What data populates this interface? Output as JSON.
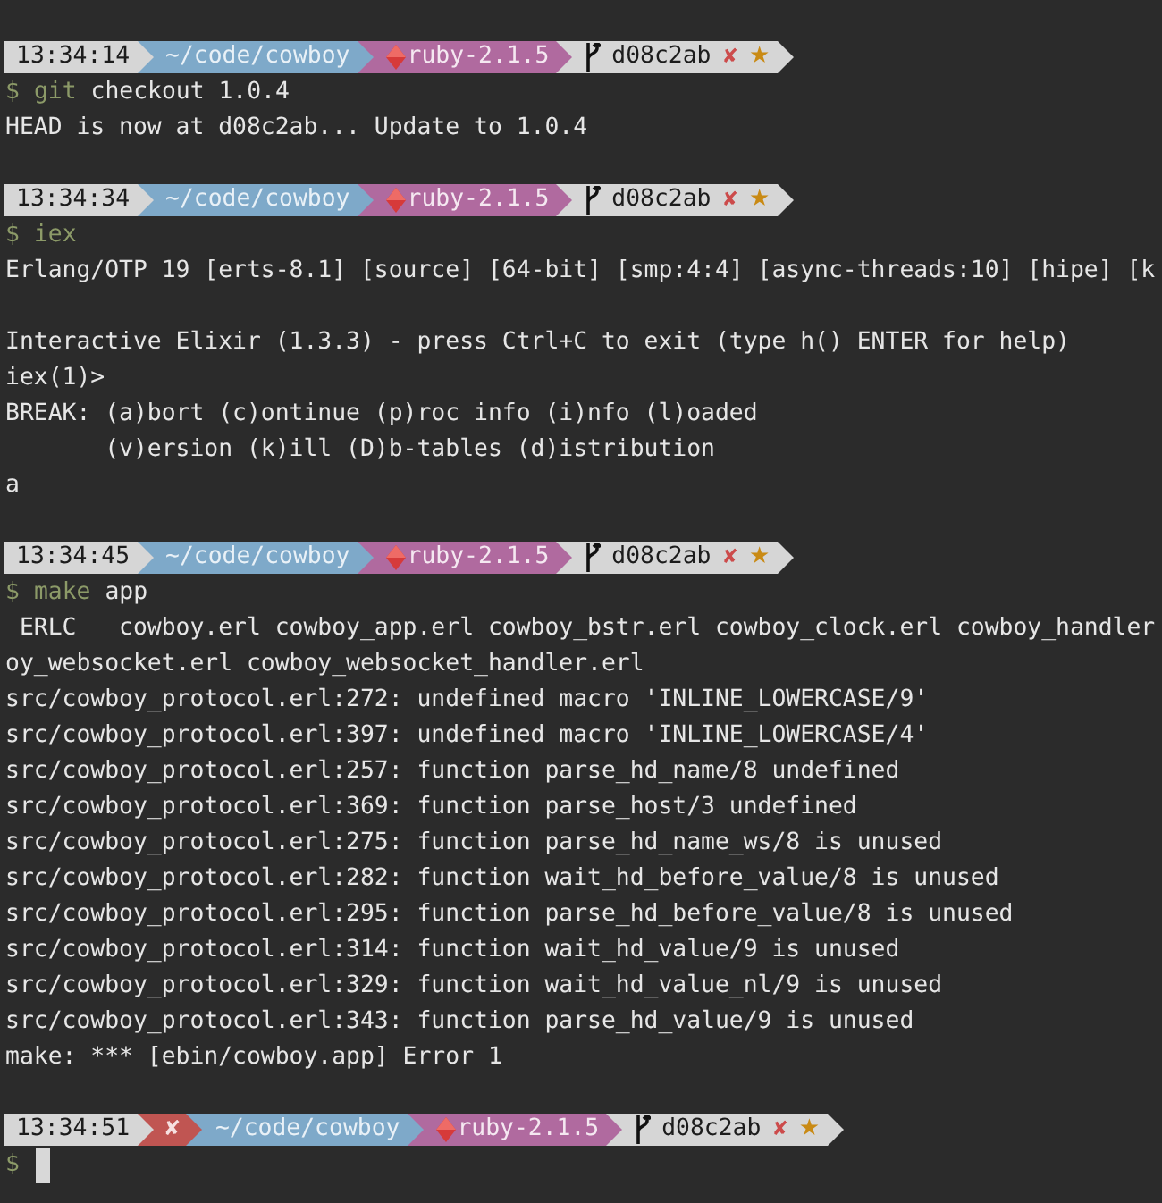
{
  "blocks": [
    {
      "prompt": {
        "segments": [
          {
            "kind": "time",
            "text": "13:34:14",
            "color": "#d6d6d6"
          },
          {
            "kind": "path",
            "text": "~/code/cowboy",
            "color": "#7ea9c9"
          },
          {
            "kind": "ruby",
            "text": "ruby-2.1.5",
            "color": "#b06a9f"
          },
          {
            "kind": "git",
            "text": "d08c2ab",
            "color": "#d6d6d6",
            "marks": [
              {
                "text": "✘",
                "color": "#cc4b4b"
              },
              {
                "text": "★",
                "color": "#c98a14"
              }
            ]
          }
        ]
      },
      "command": {
        "symbol": "$",
        "program": "git",
        "args": "checkout 1.0.4"
      },
      "output": [
        {
          "kind": "text",
          "text": "HEAD is now at d08c2ab... Update to 1.0.4"
        },
        {
          "kind": "blank"
        }
      ]
    },
    {
      "prompt": {
        "segments": [
          {
            "kind": "time",
            "text": "13:34:34",
            "color": "#d6d6d6"
          },
          {
            "kind": "path",
            "text": "~/code/cowboy",
            "color": "#7ea9c9"
          },
          {
            "kind": "ruby",
            "text": "ruby-2.1.5",
            "color": "#b06a9f"
          },
          {
            "kind": "git",
            "text": "d08c2ab",
            "color": "#d6d6d6",
            "marks": [
              {
                "text": "✘",
                "color": "#cc4b4b"
              },
              {
                "text": "★",
                "color": "#c98a14"
              }
            ]
          }
        ]
      },
      "command": {
        "symbol": "$",
        "program": "iex"
      },
      "output": [
        {
          "kind": "text",
          "text": "Erlang/OTP 19 [erts-8.1] [source] [64-bit] [smp:4:4] [async-threads:10] [hipe] [k"
        },
        {
          "kind": "blank"
        },
        {
          "kind": "text",
          "text": "Interactive Elixir (1.3.3) - press Ctrl+C to exit (type h() ENTER for help)"
        },
        {
          "kind": "text",
          "text": "iex(1)>"
        },
        {
          "kind": "text",
          "text": "BREAK: (a)bort (c)ontinue (p)roc info (i)nfo (l)oaded"
        },
        {
          "kind": "text",
          "text": "       (v)ersion (k)ill (D)b-tables (d)istribution"
        },
        {
          "kind": "text",
          "text": "a"
        },
        {
          "kind": "blank"
        }
      ]
    },
    {
      "prompt": {
        "segments": [
          {
            "kind": "time",
            "text": "13:34:45",
            "color": "#d6d6d6"
          },
          {
            "kind": "path",
            "text": "~/code/cowboy",
            "color": "#7ea9c9"
          },
          {
            "kind": "ruby",
            "text": "ruby-2.1.5",
            "color": "#b06a9f"
          },
          {
            "kind": "git",
            "text": "d08c2ab",
            "color": "#d6d6d6",
            "marks": [
              {
                "text": "✘",
                "color": "#cc4b4b"
              },
              {
                "text": "★",
                "color": "#c98a14"
              }
            ]
          }
        ]
      },
      "command": {
        "symbol": "$",
        "program": "make",
        "args": "app"
      },
      "output": [
        {
          "kind": "text",
          "text": " ERLC   cowboy.erl cowboy_app.erl cowboy_bstr.erl cowboy_clock.erl cowboy_handler"
        },
        {
          "kind": "text",
          "text": "oy_websocket.erl cowboy_websocket_handler.erl"
        },
        {
          "kind": "text",
          "text": "src/cowboy_protocol.erl:272: undefined macro 'INLINE_LOWERCASE/9'"
        },
        {
          "kind": "text",
          "text": "src/cowboy_protocol.erl:397: undefined macro 'INLINE_LOWERCASE/4'"
        },
        {
          "kind": "text",
          "text": "src/cowboy_protocol.erl:257: function parse_hd_name/8 undefined"
        },
        {
          "kind": "text",
          "text": "src/cowboy_protocol.erl:369: function parse_host/3 undefined"
        },
        {
          "kind": "text",
          "text": "src/cowboy_protocol.erl:275: function parse_hd_name_ws/8 is unused"
        },
        {
          "kind": "text",
          "text": "src/cowboy_protocol.erl:282: function wait_hd_before_value/8 is unused"
        },
        {
          "kind": "text",
          "text": "src/cowboy_protocol.erl:295: function parse_hd_before_value/8 is unused"
        },
        {
          "kind": "text",
          "text": "src/cowboy_protocol.erl:314: function wait_hd_value/9 is unused"
        },
        {
          "kind": "text",
          "text": "src/cowboy_protocol.erl:329: function wait_hd_value_nl/9 is unused"
        },
        {
          "kind": "text",
          "text": "src/cowboy_protocol.erl:343: function parse_hd_value/9 is unused"
        },
        {
          "kind": "text",
          "text": "make: *** [ebin/cowboy.app] Error 1"
        },
        {
          "kind": "blank"
        }
      ]
    },
    {
      "prompt": {
        "segments": [
          {
            "kind": "time",
            "text": "13:34:51",
            "color": "#d6d6d6"
          },
          {
            "kind": "status",
            "text": "✘",
            "color": "#c05552"
          },
          {
            "kind": "path",
            "text": "~/code/cowboy",
            "color": "#7ea9c9"
          },
          {
            "kind": "ruby",
            "text": "ruby-2.1.5",
            "color": "#b06a9f"
          },
          {
            "kind": "git",
            "text": "d08c2ab",
            "color": "#d6d6d6",
            "marks": [
              {
                "text": "✘",
                "color": "#cc4b4b"
              },
              {
                "text": "★",
                "color": "#c98a14"
              }
            ]
          }
        ]
      },
      "command": {
        "symbol": "$",
        "cursor": true
      }
    }
  ]
}
